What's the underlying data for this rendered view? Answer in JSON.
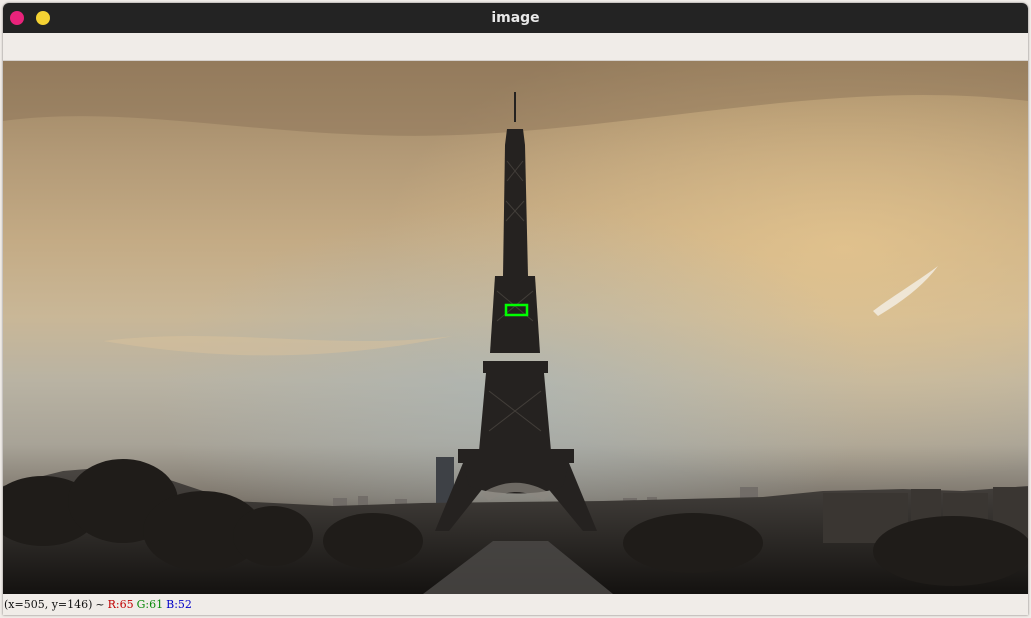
{
  "window": {
    "title": "image",
    "close_color": "#e9237b",
    "minimize_color": "#f4d233"
  },
  "image": {
    "subject": "eiffel-tower-photo",
    "roi_color": "#00ff00"
  },
  "status": {
    "coords": "(x=505, y=146)",
    "separator": "~",
    "r": "R:65",
    "g": "G:61",
    "b": "B:52"
  }
}
